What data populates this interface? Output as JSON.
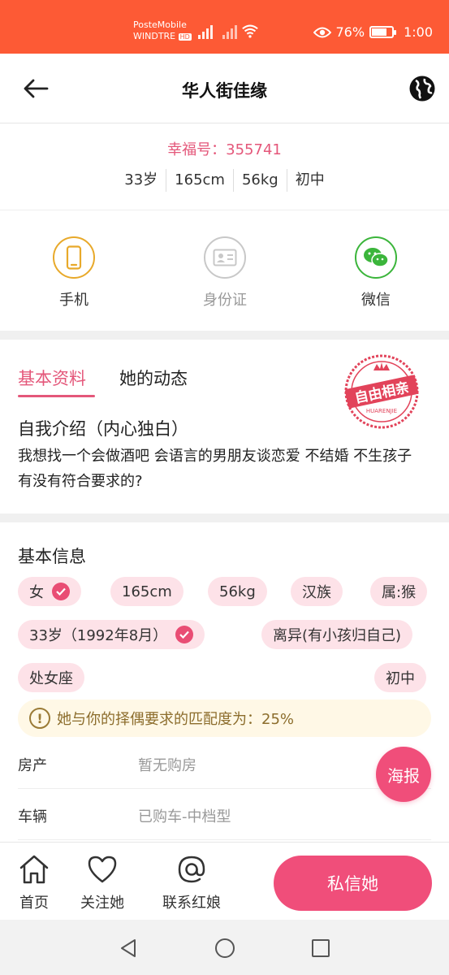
{
  "status_bar": {
    "carrier_1": "PosteMobile",
    "carrier_2": "WINDTRE",
    "carrier_2_badge": "HD",
    "battery": "76%",
    "battery_level": 0.76,
    "time": "1:00"
  },
  "header": {
    "title": "华人街佳缘"
  },
  "profile": {
    "happiness_no": "幸福号：355741",
    "age": "33岁",
    "height": "165cm",
    "weight": "56kg",
    "education": "初中"
  },
  "verify": [
    {
      "label": "手机",
      "icon": "phone-icon",
      "color": "#e8a92a"
    },
    {
      "label": "身份证",
      "icon": "id-card-icon",
      "color": "#c8c8c8"
    },
    {
      "label": "微信",
      "icon": "wechat-icon",
      "color": "#3bb53b"
    }
  ],
  "tabs": {
    "basic": "基本资料",
    "moments": "她的动态"
  },
  "stamp": {
    "text": "自由相亲",
    "sub": "HUARENJIE"
  },
  "intro": {
    "title": "自我介绍（内心独白）",
    "text": "我想找一个会做酒吧 会语言的男朋友谈恋爱 不结婚 不生孩子 有没有符合要求的?"
  },
  "basic_info": {
    "title": "基本信息",
    "chips": {
      "gender": "女",
      "height": "165cm",
      "weight": "56kg",
      "ethnicity": "汉族",
      "zodiac": "属:猴",
      "age": "33岁（1992年8月）",
      "marital": "离异(有小孩归自己)",
      "constellation": "处女座",
      "education": "初中"
    },
    "match": "她与你的择偶要求的匹配度为：25%",
    "rows": [
      {
        "key": "房产",
        "value": "暂无购房"
      },
      {
        "key": "车辆",
        "value": "已购车-中档型"
      }
    ],
    "poster": "海报"
  },
  "actions": {
    "home": "首页",
    "follow": "关注她",
    "contact": "联系红娘",
    "message": "私信她"
  },
  "colors": {
    "accent": "#e4577a",
    "status_bar": "#fd5a35",
    "chip_bg": "#fde2e8"
  }
}
